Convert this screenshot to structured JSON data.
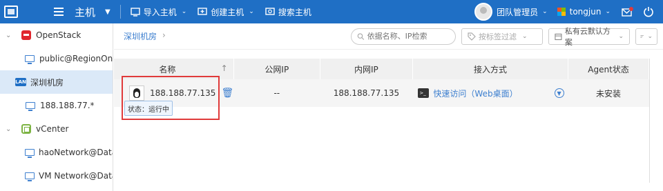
{
  "header": {
    "title": "主机",
    "menu": [
      {
        "label": "导入主机",
        "icon": "import-icon"
      },
      {
        "label": "创建主机",
        "icon": "create-icon"
      },
      {
        "label": "搜索主机",
        "icon": "search-host-icon"
      }
    ],
    "team": "团队管理员",
    "user": "tongjun"
  },
  "sidebar": {
    "items": [
      {
        "label": "OpenStack",
        "icon": "openstack-icon",
        "expanded": true
      },
      {
        "label": "public@RegionOne",
        "icon": "network-icon"
      },
      {
        "label": "深圳机房",
        "icon": "lan-icon",
        "selected": true,
        "badge": "LAN"
      },
      {
        "label": "188.188.77.*",
        "icon": "network-icon"
      },
      {
        "label": "vCenter",
        "icon": "vcenter-icon",
        "expanded": true
      },
      {
        "label": "haoNetwork@Data...",
        "icon": "network-icon"
      },
      {
        "label": "VM Network@Data...",
        "icon": "network-icon"
      }
    ]
  },
  "toolbar": {
    "breadcrumb": "深圳机房",
    "search_placeholder": "依据名称、IP检索",
    "tag_filter_placeholder": "按标签过滤",
    "cloud_plan": "私有云默认方案"
  },
  "table": {
    "columns": [
      "名称",
      "公网IP",
      "内网IP",
      "接入方式",
      "Agent状态"
    ],
    "rows": [
      {
        "name": "188.188.77.135",
        "public_ip": "--",
        "private_ip": "188.188.77.135",
        "access": "快速访问（Web桌面）",
        "agent_status": "未安装",
        "tooltip": "状态：运行中"
      }
    ]
  },
  "colors": {
    "primary": "#1f6fc5",
    "highlight": "#e03a3a",
    "selected": "#dbe9f8"
  }
}
